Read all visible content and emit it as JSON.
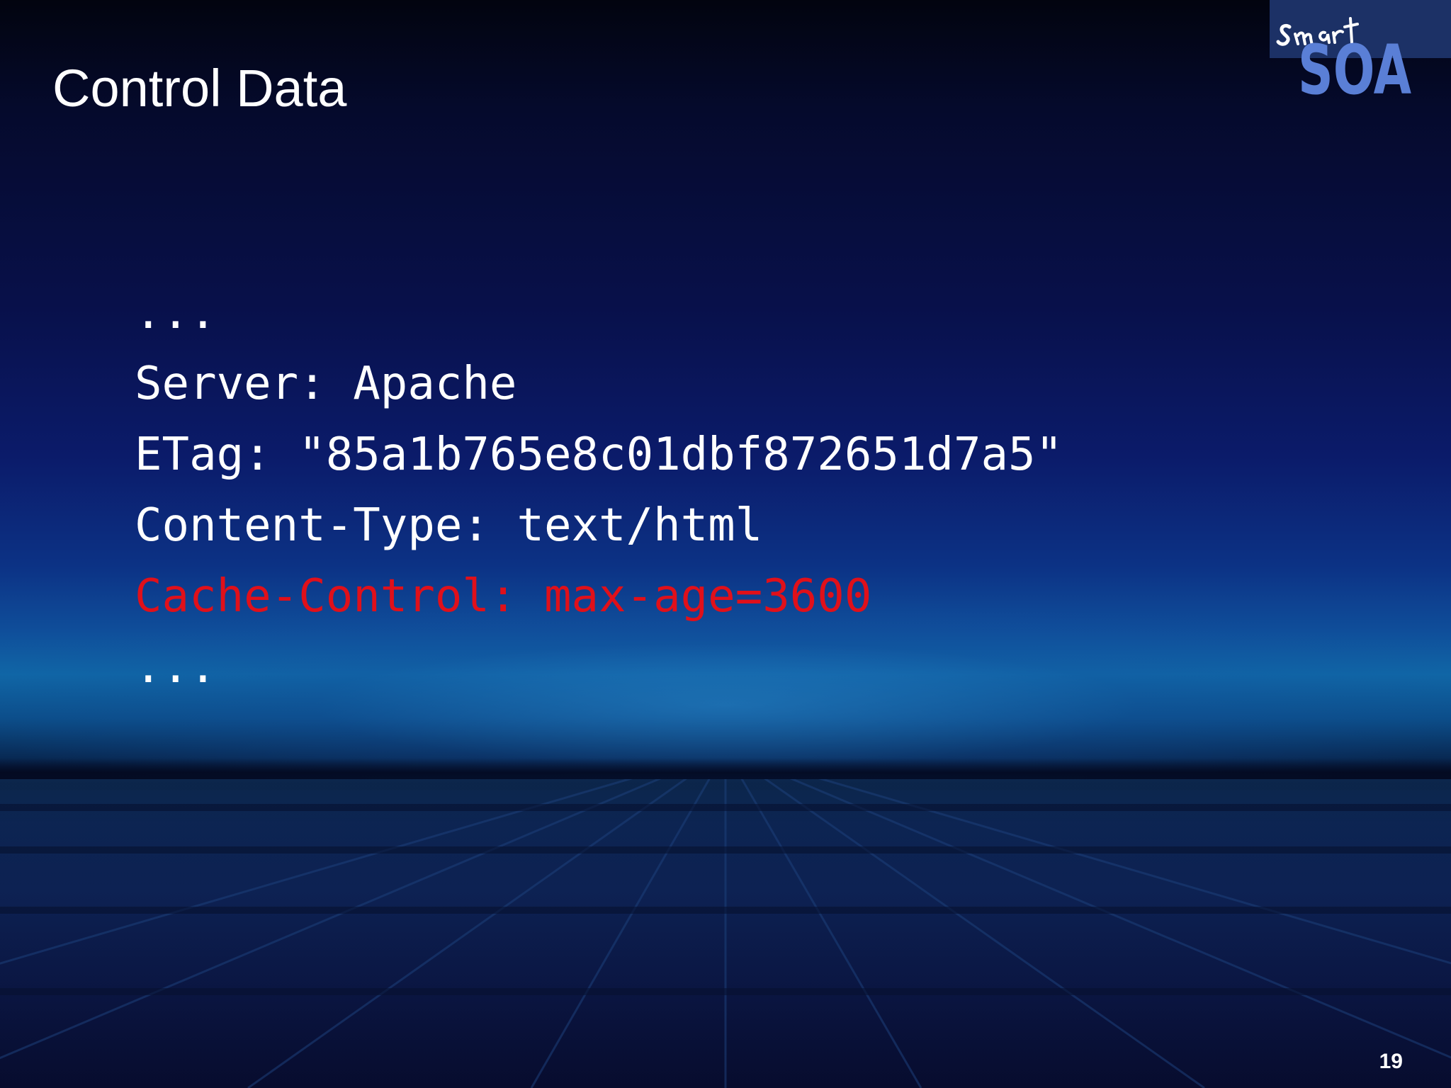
{
  "slide": {
    "title": "Control Data",
    "page_number": "19"
  },
  "logo": {
    "script_text": "Smart",
    "block_text": "SOA"
  },
  "code": {
    "lines": [
      {
        "text": "...",
        "highlight": false
      },
      {
        "text": "Server: Apache",
        "highlight": false
      },
      {
        "text": "ETag: \"85a1b765e8c01dbf872651d7a5\"",
        "highlight": false
      },
      {
        "text": "Content-Type: text/html",
        "highlight": false
      },
      {
        "text": "Cache-Control: max-age=3600",
        "highlight": true
      },
      {
        "text": "...",
        "highlight": false
      }
    ]
  },
  "colors": {
    "highlight": "#e0101a",
    "text": "#ffffff",
    "logo_block": "#5a7fd6",
    "logo_panel": "#1c3166"
  }
}
